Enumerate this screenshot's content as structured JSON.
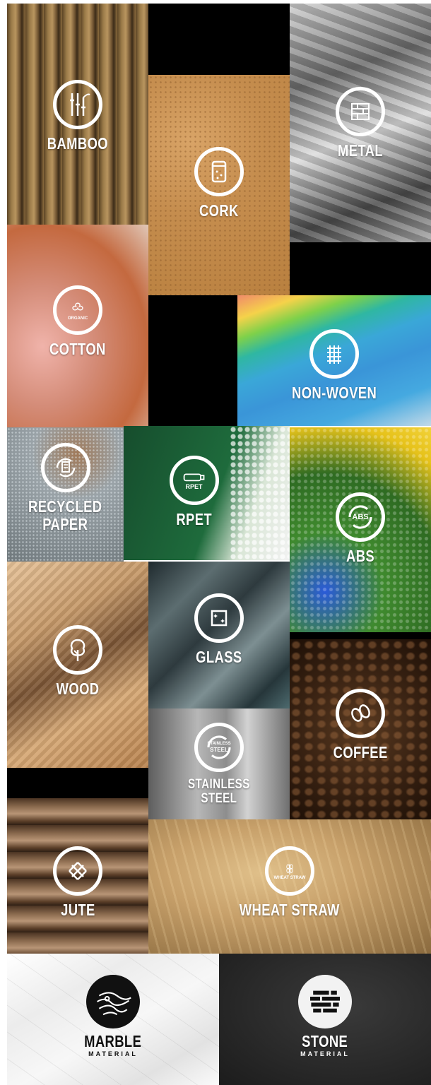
{
  "materials": {
    "bamboo": {
      "label": "BAMBOO",
      "icon": "bamboo-icon"
    },
    "cork": {
      "label": "CORK",
      "icon": "cork-jar-icon"
    },
    "metal": {
      "label": "METAL",
      "icon": "metal-icon"
    },
    "cotton": {
      "label": "COTTON",
      "icon": "cotton-organic-icon",
      "badge": "ORGANIC"
    },
    "nonwoven": {
      "label": "NON-WOVEN",
      "icon": "woven-mesh-icon"
    },
    "recycled_paper": {
      "label": "RECYCLED\nPAPER",
      "icon": "recycled-paper-icon"
    },
    "rpet": {
      "label": "RPET",
      "icon": "rpet-bottle-icon",
      "badge": "RPET"
    },
    "abs": {
      "label": "ABS",
      "icon": "abs-recycle-icon",
      "badge": "ABS"
    },
    "wood": {
      "label": "WOOD",
      "icon": "tree-icon"
    },
    "glass": {
      "label": "GLASS",
      "icon": "glass-icon"
    },
    "coffee": {
      "label": "COFFEE",
      "icon": "coffee-bean-icon"
    },
    "stainless": {
      "label": "STAINLESS\nSTEEL",
      "icon": "stainless-steel-icon",
      "badge_line1": "STAINLESS",
      "badge_line2": "STEEL"
    },
    "jute": {
      "label": "JUTE",
      "icon": "jute-weave-icon"
    },
    "wheat": {
      "label": "WHEAT STRAW",
      "icon": "wheat-straw-icon",
      "badge": "WHEAT STRAW"
    },
    "marble": {
      "label": "MARBLE",
      "sub": "MATERIAL",
      "icon": "marble-icon"
    },
    "stone": {
      "label": "STONE",
      "sub": "MATERIAL",
      "icon": "stone-icon"
    }
  },
  "colors": {
    "bamboo": "#8a6a3d",
    "cork": "#c58d4e",
    "metal": "#8f8f8f",
    "cotton": "#d48c78",
    "nonwoven": "#3aa7d8",
    "paper": "#a7a7a7",
    "rpet": "#1e6b3c",
    "abs": "#3f8a2e",
    "wood": "#c79a6a",
    "glass": "#4a5a60",
    "coffee": "#3a2313",
    "steel": "#8d8d8d",
    "jute": "#7a5a3e",
    "wheat": "#c7a06a",
    "marble": "#f1f1f1",
    "stone": "#2b2b2b"
  }
}
